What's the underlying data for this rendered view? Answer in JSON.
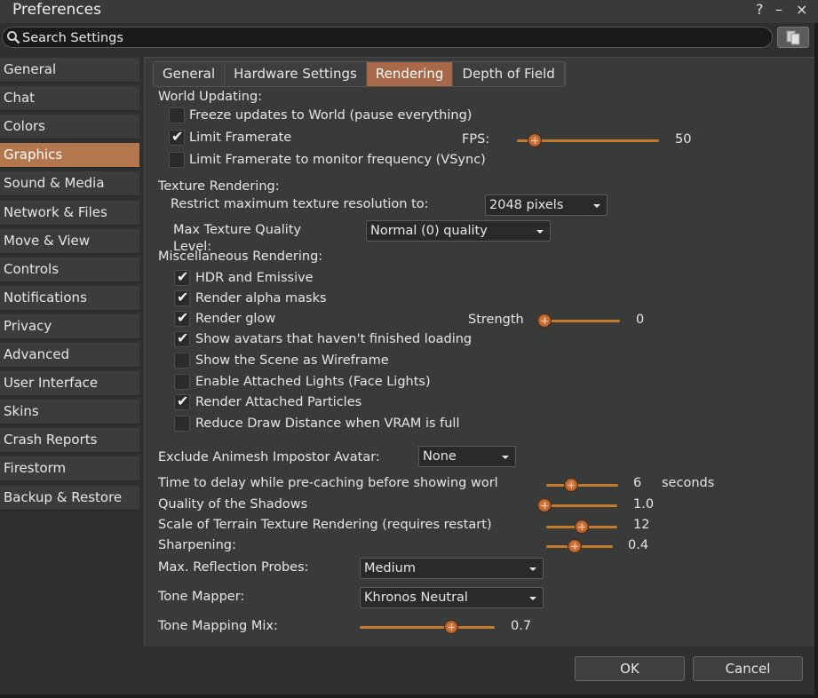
{
  "window": {
    "title": "Preferences",
    "help_glyph": "?",
    "minimize_glyph": "–",
    "close_glyph": "×"
  },
  "search": {
    "placeholder": "Search Settings"
  },
  "sidebar": {
    "items": [
      {
        "label": "General"
      },
      {
        "label": "Chat"
      },
      {
        "label": "Colors"
      },
      {
        "label": "Graphics"
      },
      {
        "label": "Sound & Media"
      },
      {
        "label": "Network & Files"
      },
      {
        "label": "Move & View"
      },
      {
        "label": "Controls"
      },
      {
        "label": "Notifications"
      },
      {
        "label": "Privacy"
      },
      {
        "label": "Advanced"
      },
      {
        "label": "User Interface"
      },
      {
        "label": "Skins"
      },
      {
        "label": "Crash Reports"
      },
      {
        "label": "Firestorm"
      },
      {
        "label": "Backup & Restore"
      }
    ],
    "active": "Graphics"
  },
  "tabs": [
    {
      "label": "General"
    },
    {
      "label": "Hardware Settings"
    },
    {
      "label": "Rendering"
    },
    {
      "label": "Depth of Field"
    }
  ],
  "active_tab": "Rendering",
  "world_updating": {
    "heading": "World Updating:",
    "freeze": {
      "label": "Freeze updates to World (pause everything)",
      "checked": false
    },
    "limit_framerate": {
      "label": "Limit Framerate",
      "checked": true
    },
    "fps_label": "FPS:",
    "fps_value": "50",
    "fps_fraction": 0.08,
    "vsync": {
      "label": "Limit Framerate to monitor frequency (VSync)",
      "checked": false
    }
  },
  "texture_rendering": {
    "heading": "Texture Rendering:",
    "restrict_label": "Restrict maximum texture resolution to:",
    "restrict_value": "2048 pixels",
    "quality_label_line1": "Max Texture Quality",
    "quality_label_line2": "Level:",
    "quality_value": "Normal (0) quality"
  },
  "misc_rendering": {
    "heading": "Miscellaneous Rendering:",
    "options": [
      {
        "label": "HDR and Emissive",
        "checked": true
      },
      {
        "label": "Render alpha masks",
        "checked": true
      },
      {
        "label": "Render glow",
        "checked": true
      },
      {
        "label": "Show avatars that haven't finished loading",
        "checked": true
      },
      {
        "label": "Show the Scene as Wireframe",
        "checked": false
      },
      {
        "label": "Enable Attached Lights (Face Lights)",
        "checked": false
      },
      {
        "label": "Render Attached Particles",
        "checked": true
      },
      {
        "label": "Reduce Draw Distance when VRAM is full",
        "checked": false
      }
    ],
    "strength_label": "Strength",
    "strength_value": "0",
    "strength_fraction": 0.0
  },
  "exclude_animesh": {
    "label": "Exclude Animesh Impostor Avatar:",
    "value": "None"
  },
  "precache": {
    "label": "Time to delay while pre-caching before showing worl",
    "value": "6",
    "unit": "seconds",
    "fraction": 0.3
  },
  "shadows": {
    "label": "Quality of the Shadows",
    "value": "1.0",
    "fraction": 0.0
  },
  "terrain_scale": {
    "label": "Scale of Terrain Texture Rendering (requires restart)",
    "value": "12",
    "fraction": 0.5
  },
  "sharpening": {
    "label": "Sharpening:",
    "value": "0.4",
    "fraction": 0.4
  },
  "reflection_probes": {
    "label": "Max. Reflection Probes:",
    "value": "Medium"
  },
  "tone_mapper": {
    "label": "Tone Mapper:",
    "value": "Khronos Neutral"
  },
  "tone_mix": {
    "label": "Tone Mapping Mix:",
    "value": "0.7",
    "fraction": 0.7
  },
  "buttons": {
    "ok": "OK",
    "cancel": "Cancel"
  },
  "colors": {
    "accent": "#b3764d",
    "slider": "#c47a2b",
    "panel": "#393b3a",
    "background": "#2f3130"
  }
}
